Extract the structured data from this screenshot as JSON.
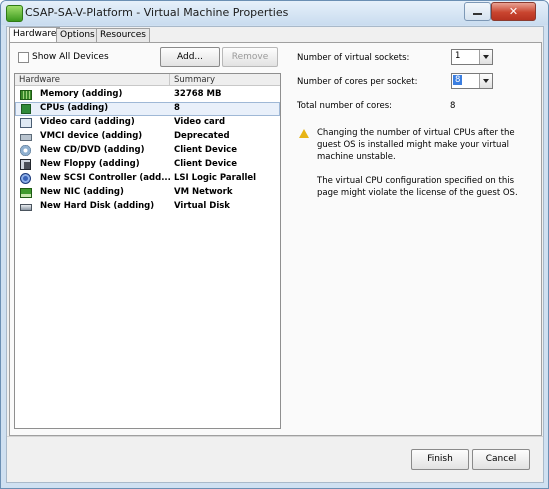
{
  "window": {
    "title": "CSAP-SA-V-Platform - Virtual Machine Properties",
    "close_glyph": "✕",
    "icons": {
      "app": "vm-app-icon",
      "minimize": "minimize-icon",
      "close": "close-icon"
    }
  },
  "tabs": [
    {
      "label": "Hardware",
      "active": true
    },
    {
      "label": "Options",
      "active": false
    },
    {
      "label": "Resources",
      "active": false
    }
  ],
  "hardware_panel": {
    "show_all_devices_label": "Show All Devices",
    "show_all_devices_checked": false,
    "add_label": "Add...",
    "remove_label": "Remove",
    "remove_enabled": false,
    "columns": [
      "Hardware",
      "Summary"
    ],
    "rows": [
      {
        "name": "Memory (adding)",
        "summary": "32768 MB",
        "icon": "memory-icon",
        "selected": false
      },
      {
        "name": "CPUs (adding)",
        "summary": "8",
        "icon": "cpu-icon",
        "selected": true
      },
      {
        "name": "Video card  (adding)",
        "summary": "Video card",
        "icon": "video-card-icon",
        "selected": false
      },
      {
        "name": "VMCI device (adding)",
        "summary": "Deprecated",
        "icon": "vmci-device-icon",
        "selected": false
      },
      {
        "name": "New CD/DVD (adding)",
        "summary": "Client Device",
        "icon": "cd-dvd-icon",
        "selected": false
      },
      {
        "name": "New Floppy (adding)",
        "summary": "Client Device",
        "icon": "floppy-icon",
        "selected": false
      },
      {
        "name": "New SCSI Controller (add...",
        "summary": "LSI Logic Parallel",
        "icon": "scsi-controller-icon",
        "selected": false
      },
      {
        "name": "New NIC (adding)",
        "summary": "VM Network",
        "icon": "nic-icon",
        "selected": false
      },
      {
        "name": "New Hard Disk (adding)",
        "summary": "Virtual Disk",
        "icon": "hard-disk-icon",
        "selected": false
      }
    ]
  },
  "cpu_config": {
    "sockets_label": "Number of virtual sockets:",
    "sockets_value": "1",
    "cores_label": "Number of cores per socket:",
    "cores_value": "8",
    "total_label": "Total number of cores:",
    "total_value": "8",
    "warning_icon": "warning-icon",
    "warning_text": "Changing the number of virtual CPUs after the guest OS is installed might make your virtual machine unstable.",
    "license_text": "The virtual CPU configuration specified on this page might violate the license of the guest OS."
  },
  "footer": {
    "finish_label": "Finish",
    "cancel_label": "Cancel"
  }
}
